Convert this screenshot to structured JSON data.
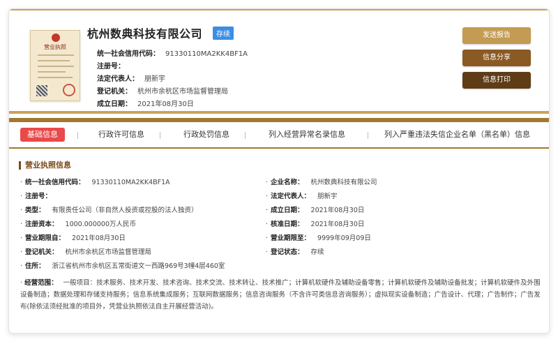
{
  "header": {
    "company_name": "杭州数典科技有限公司",
    "status": "存续",
    "license_image_title": "营业执照",
    "info": [
      {
        "label": "统一社会信用代码：",
        "value": "91330110MA2KK4BF1A"
      },
      {
        "label": "注册号：",
        "value": ""
      },
      {
        "label": "法定代表人：",
        "value": "朋新宇"
      },
      {
        "label": "登记机关：",
        "value": "杭州市余杭区市场监督管理局"
      },
      {
        "label": "成立日期：",
        "value": "2021年08月30日"
      }
    ]
  },
  "actions": {
    "send_report": "发送报告",
    "share": "信息分享",
    "print": "信息打印"
  },
  "tabs": [
    {
      "label": "基础信息",
      "active": true
    },
    {
      "label": "行政许可信息",
      "active": false
    },
    {
      "label": "行政处罚信息",
      "active": false
    },
    {
      "label": "列入经营异常名录信息",
      "active": false
    },
    {
      "label": "列入严重违法失信企业名单（黑名单）信息",
      "active": false
    }
  ],
  "section": {
    "title": "营业执照信息",
    "bullet": "·",
    "left_fields": [
      {
        "label": "统一社会信用代码：",
        "value": "91330110MA2KK4BF1A"
      },
      {
        "label": "注册号：",
        "value": ""
      },
      {
        "label": "类型：",
        "value": "有限责任公司（非自然人投资或控股的法人独资）"
      },
      {
        "label": "注册资本：",
        "value": "1000.000000万人民币"
      },
      {
        "label": "营业期限自：",
        "value": "2021年08月30日"
      },
      {
        "label": "登记机关：",
        "value": "杭州市余杭区市场监督管理局"
      },
      {
        "label": "住所：",
        "value": "浙江省杭州市余杭区五常街道文一西路969号3幢4层460室"
      }
    ],
    "right_fields": [
      {
        "label": "企业名称：",
        "value": "杭州数典科技有限公司"
      },
      {
        "label": "法定代表人：",
        "value": "朋新宇"
      },
      {
        "label": "成立日期：",
        "value": "2021年08月30日"
      },
      {
        "label": "核准日期：",
        "value": "2021年08月30日"
      },
      {
        "label": "营业期限至：",
        "value": "9999年09月09日"
      },
      {
        "label": "登记状态：",
        "value": "存续"
      }
    ],
    "scope": {
      "label": "经营范围：",
      "value": "一般项目：技术服务、技术开发、技术咨询、技术交流、技术转让、技术推广；计算机软硬件及辅助设备零售；计算机软硬件及辅助设备批发；计算机软硬件及外围设备制造；数据处理和存储支持服务；信息系统集成服务；互联网数据服务；信息咨询服务（不含许可类信息咨询服务）；虚拟现实设备制造；广告设计、代理；广告制作；广告发布(除依法须经批准的项目外，凭营业执照依法自主开展经营活动)。"
    }
  },
  "colors": {
    "accent_gold": "#c9a35a",
    "accent_brown": "#7a4a1a",
    "tab_active": "#e84a4a",
    "status_tag": "#3a8ee6"
  }
}
